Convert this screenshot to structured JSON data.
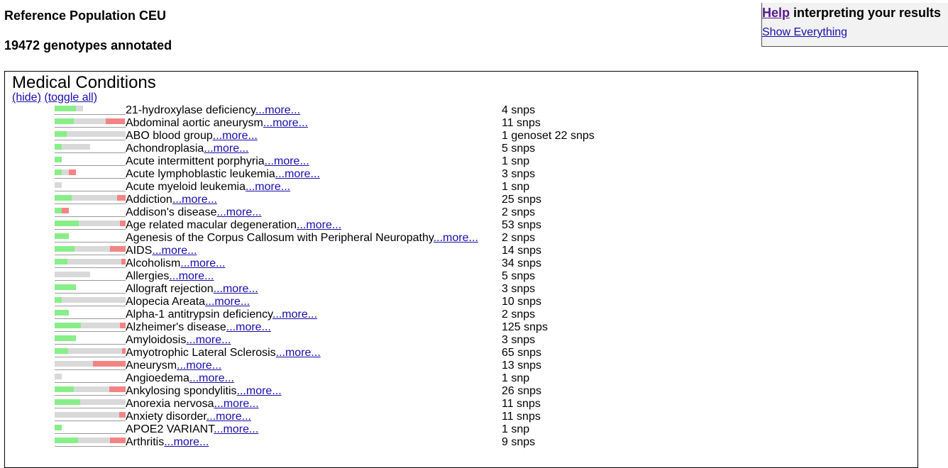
{
  "header": {
    "population": "Reference Population CEU",
    "genotypes": "19472 genotypes annotated"
  },
  "help": {
    "help_link": "Help",
    "help_text": " interpreting your results",
    "show_everything": "Show Everything"
  },
  "panel": {
    "title": "Medical Conditions",
    "hide": "(hide)",
    "toggle_all": "(toggle all)",
    "more_label": "...more...",
    "rows": [
      {
        "name": "21-hydroxylase deficiency",
        "count": "4 snps",
        "bar": [
          30,
          10,
          0
        ]
      },
      {
        "name": "Abdominal aortic aneurysm",
        "count": "11 snps",
        "bar": [
          27,
          45,
          27
        ]
      },
      {
        "name": "ABO blood group",
        "count": "1 genoset 22 snps",
        "bar": [
          17,
          83,
          0
        ]
      },
      {
        "name": "Achondroplasia",
        "count": "5 snps",
        "bar": [
          10,
          40,
          0
        ]
      },
      {
        "name": "Acute intermittent porphyria",
        "count": "1 snp",
        "bar": [
          10,
          0,
          0
        ]
      },
      {
        "name": "Acute lymphoblastic leukemia",
        "count": "3 snps",
        "bar": [
          10,
          10,
          10
        ]
      },
      {
        "name": "Acute myeloid leukemia",
        "count": "1 snp",
        "bar": [
          0,
          10,
          0
        ]
      },
      {
        "name": "Addiction",
        "count": "25 snps",
        "bar": [
          24,
          64,
          12
        ]
      },
      {
        "name": "Addison's disease",
        "count": "2 snps",
        "bar": [
          10,
          0,
          10
        ]
      },
      {
        "name": "Age related macular degeneration",
        "count": "53 snps",
        "bar": [
          34,
          58,
          8
        ]
      },
      {
        "name": "Agenesis of the Corpus Callosum with Peripheral Neuropathy",
        "count": " 2 snps",
        "bar": [
          20,
          0,
          0
        ]
      },
      {
        "name": "AIDS",
        "count": "14 snps",
        "bar": [
          28,
          50,
          22
        ]
      },
      {
        "name": "Alcoholism",
        "count": "34 snps",
        "bar": [
          18,
          76,
          6
        ]
      },
      {
        "name": "Allergies",
        "count": "5 snps",
        "bar": [
          0,
          50,
          0
        ]
      },
      {
        "name": "Allograft rejection",
        "count": "3 snps",
        "bar": [
          30,
          0,
          0
        ]
      },
      {
        "name": "Alopecia Areata",
        "count": "10 snps",
        "bar": [
          10,
          90,
          0
        ]
      },
      {
        "name": "Alpha-1 antitrypsin deficiency",
        "count": "2 snps",
        "bar": [
          20,
          0,
          0
        ]
      },
      {
        "name": "Alzheimer's disease",
        "count": "125 snps",
        "bar": [
          37,
          55,
          8
        ]
      },
      {
        "name": "Amyloidosis",
        "count": "3 snps",
        "bar": [
          30,
          0,
          0
        ]
      },
      {
        "name": "Amyotrophic Lateral Sclerosis",
        "count": "65 snps",
        "bar": [
          19,
          76,
          5
        ]
      },
      {
        "name": "Aneurysm",
        "count": "13 snps",
        "bar": [
          0,
          54,
          46
        ]
      },
      {
        "name": "Angioedema",
        "count": "1 snp",
        "bar": [
          0,
          10,
          0
        ]
      },
      {
        "name": "Ankylosing spondylitis",
        "count": "26 snps",
        "bar": [
          27,
          50,
          23
        ]
      },
      {
        "name": "Anorexia nervosa",
        "count": "11 snps",
        "bar": [
          36,
          64,
          0
        ]
      },
      {
        "name": "Anxiety disorder",
        "count": "11 snps",
        "bar": [
          0,
          91,
          9
        ]
      },
      {
        "name": "APOE2 VARIANT",
        "count": "1 snp",
        "bar": [
          10,
          0,
          0
        ]
      },
      {
        "name": "Arthritis",
        "count": "9 snps",
        "bar": [
          33,
          45,
          22
        ]
      }
    ]
  },
  "colors": {
    "green": "#88ee88",
    "grey": "#d9d9d9",
    "red": "#f48484",
    "link": "#1a0dab",
    "visited": "#551a8b"
  }
}
